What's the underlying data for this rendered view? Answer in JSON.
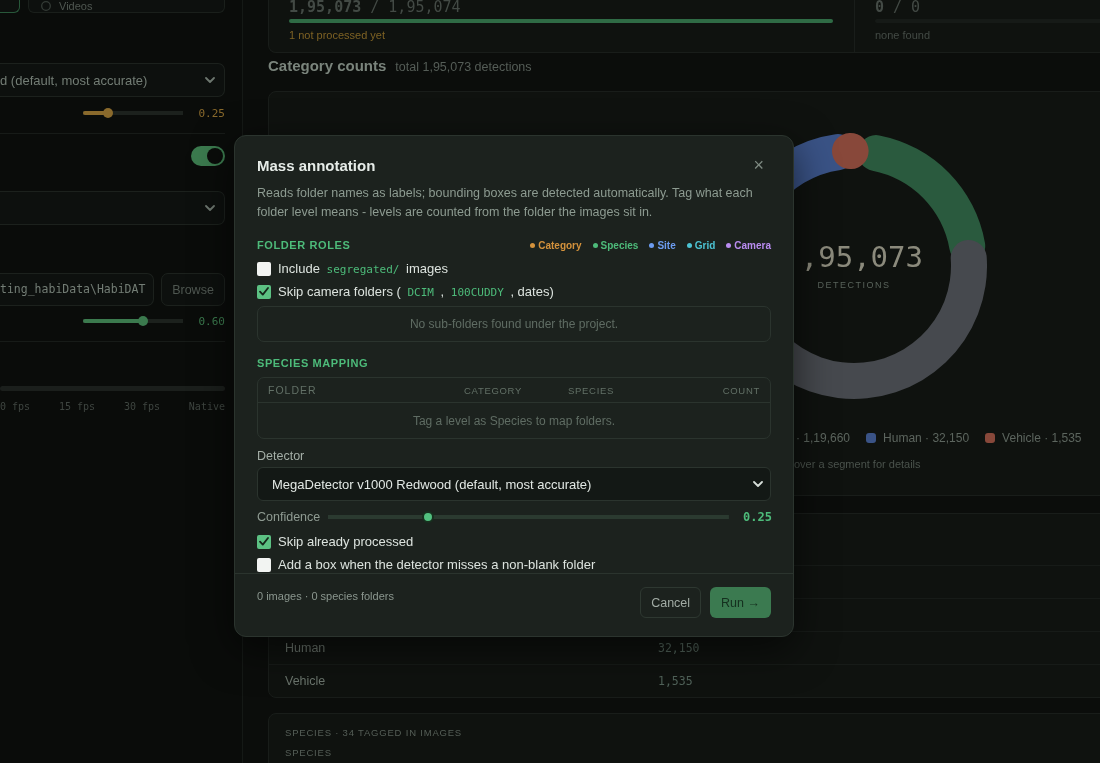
{
  "sidebar": {
    "media_options": [
      {
        "selected": true
      },
      {
        "label": "Videos",
        "selected": false
      }
    ],
    "controls": [
      {
        "kind": "select",
        "value": "d (default, most accurate)"
      },
      {
        "kind": "slider",
        "level": 0.25,
        "reading": "0.25",
        "color": "#8a6a2c"
      },
      {
        "kind": "toggle",
        "on": true
      },
      {
        "kind": "select"
      },
      {
        "kind": "path",
        "value": "ting_habiData\\HabiDAT",
        "button": "Browse"
      },
      {
        "kind": "slider",
        "level": 0.6,
        "reading": "0.60",
        "color": "#3b7a4e"
      },
      {
        "kind": "ticks",
        "labels": [
          "0 fps",
          "15 fps",
          "30 fps",
          "Native"
        ]
      }
    ]
  },
  "main": {
    "stats": [
      {
        "value": "**1,95,073** / 1,95,074",
        "level": 1,
        "note": "1 not processed yet",
        "warning": true
      },
      {
        "value": "**0** / 0",
        "note": "none found",
        "warning": false
      }
    ],
    "category_counts": {
      "title": "Category counts",
      "subtitle": "total 1,95,073 detections",
      "center_value": ",95,073",
      "center_label": "DETECTIONS",
      "legend": [
        {
          "label": "· 1,19,660"
        },
        {
          "label": "Human · 32,150",
          "color": "#3a5386"
        },
        {
          "label": "Vehicle · 1,535",
          "color": "#88483a"
        }
      ],
      "hint": "over a segment for details"
    },
    "table": {
      "rows": [
        {
          "name": "Human",
          "count": "32,150"
        },
        {
          "name": "Vehicle",
          "count": "1,535"
        }
      ]
    },
    "species": {
      "title": "SPECIES · 34 TAGGED IN IMAGES",
      "column": "SPECIES"
    }
  },
  "modal": {
    "title": "Mass annotation",
    "close": "×",
    "description": "Reads folder names as labels; bounding boxes are detected automatically. Tag what each folder level means - levels are counted from the folder the images sit in.",
    "folder_roles": {
      "heading": "FOLDER ROLES",
      "legend": [
        {
          "label": "Category",
          "color": "#d4923c"
        },
        {
          "label": "Species",
          "color": "#4dbb7a"
        },
        {
          "label": "Site",
          "color": "#6c9cf0"
        },
        {
          "label": "Grid",
          "color": "#4cc3d3"
        },
        {
          "label": "Camera",
          "color": "#b98cf0"
        }
      ],
      "options": [
        {
          "parts": [
            {
              "kind": "text",
              "text": "Include "
            },
            {
              "kind": "code",
              "text": "segregated/"
            },
            {
              "kind": "text",
              "text": " images"
            }
          ],
          "checked": false
        },
        {
          "parts": [
            {
              "kind": "text",
              "text": "Skip camera folders ( "
            },
            {
              "kind": "code",
              "text": "DCIM"
            },
            {
              "kind": "text",
              "text": " , "
            },
            {
              "kind": "code",
              "text": "100CUDDY"
            },
            {
              "kind": "text",
              "text": " , dates)"
            }
          ],
          "checked": true
        }
      ],
      "empty_message": "No sub-folders found under the project."
    },
    "species_mapping": {
      "heading": "SPECIES MAPPING",
      "columns": [
        "FOLDER",
        "CATEGORY",
        "SPECIES",
        "COUNT"
      ],
      "empty_message": "Tag a level as Species to map folders."
    },
    "detector": {
      "label": "Detector",
      "value": "MegaDetector v1000 Redwood (default, most accurate)"
    },
    "confidence": {
      "label": "Confidence",
      "level": 0.25,
      "reading": "0.25"
    },
    "options": [
      {
        "label": "Skip already processed",
        "checked": true
      },
      {
        "label": "Add a box when the detector misses a non-blank folder",
        "checked": false
      }
    ],
    "summary": "0 images · 0 species folders",
    "buttons": [
      {
        "label": "Cancel",
        "kind": "secondary"
      },
      {
        "label": "Run →",
        "kind": "primary"
      }
    ]
  }
}
